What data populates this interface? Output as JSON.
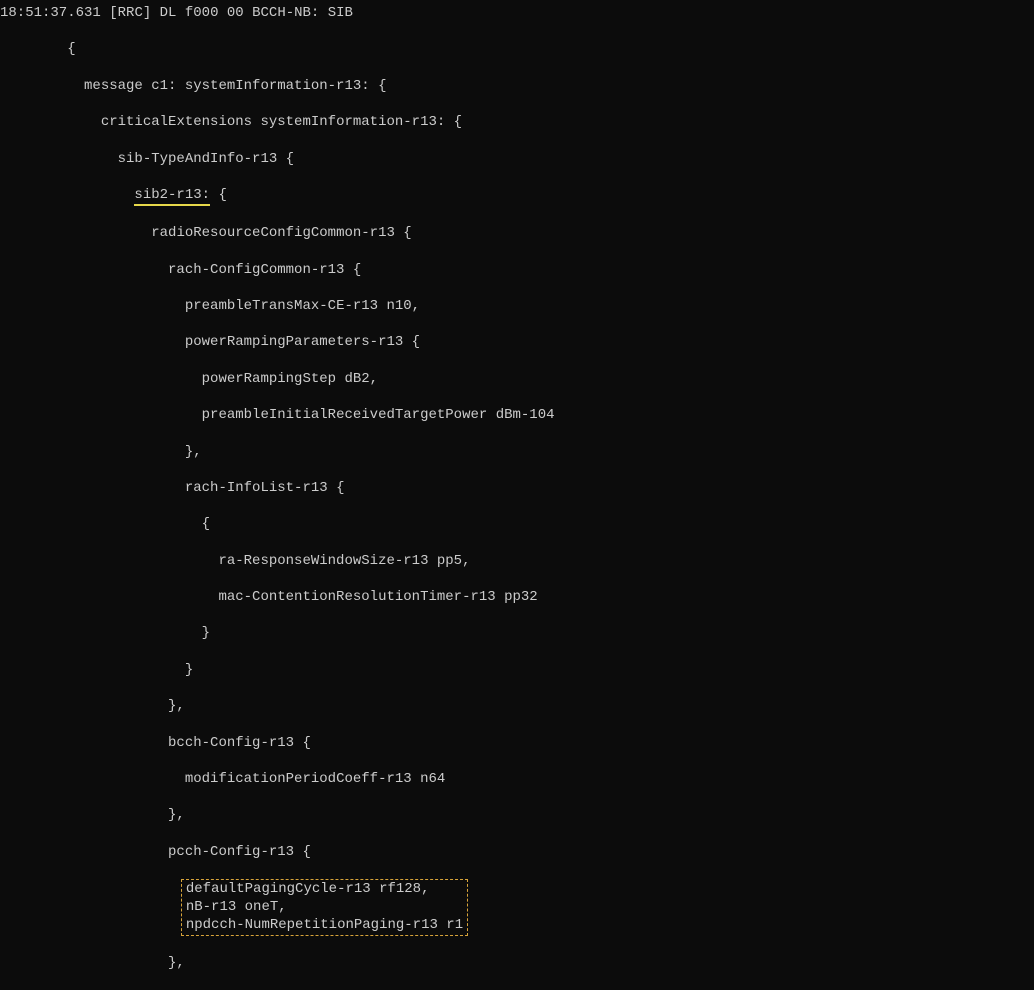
{
  "log": {
    "timestamp": "18:51:37.631",
    "tag": "[RRC]",
    "direction": "DL",
    "code1": "f000",
    "code2": "00",
    "channel": "BCCH-NB:",
    "msgtype": "SIB"
  },
  "l": {
    "obrace": "{",
    "message": "message c1: systemInformation-r13: {",
    "critext": "criticalExtensions systemInformation-r13: {",
    "sibtype": "sib-TypeAndInfo-r13 {",
    "sib2_underline": "sib2-r13:",
    "sib2_after": " {",
    "rrcc": "radioResourceConfigCommon-r13 {",
    "rach": "rach-ConfigCommon-r13 {",
    "preamble": "preambleTransMax-CE-r13 n10,",
    "prp": "powerRampingParameters-r13 {",
    "prs": "powerRampingStep dB2,",
    "pirt": "preambleInitialReceivedTargetPower dBm-104",
    "close": "},",
    "rachinfo": "rach-InfoList-r13 {",
    "obr": "{",
    "raResp": "ra-ResponseWindowSize-r13 pp5,",
    "macCont": "mac-ContentionResolutionTimer-r13 pp32",
    "closebr": "}",
    "bcch": "bcch-Config-r13 {",
    "modper": "modificationPeriodCoeff-r13 n64",
    "pcch": "pcch-Config-r13 {",
    "defPaging": "defaultPagingCycle-r13 rf128,",
    "nB": "nB-r13 oneT,",
    "npdcch": "npdcch-NumRepetitionPaging-r13 r1"
  }
}
